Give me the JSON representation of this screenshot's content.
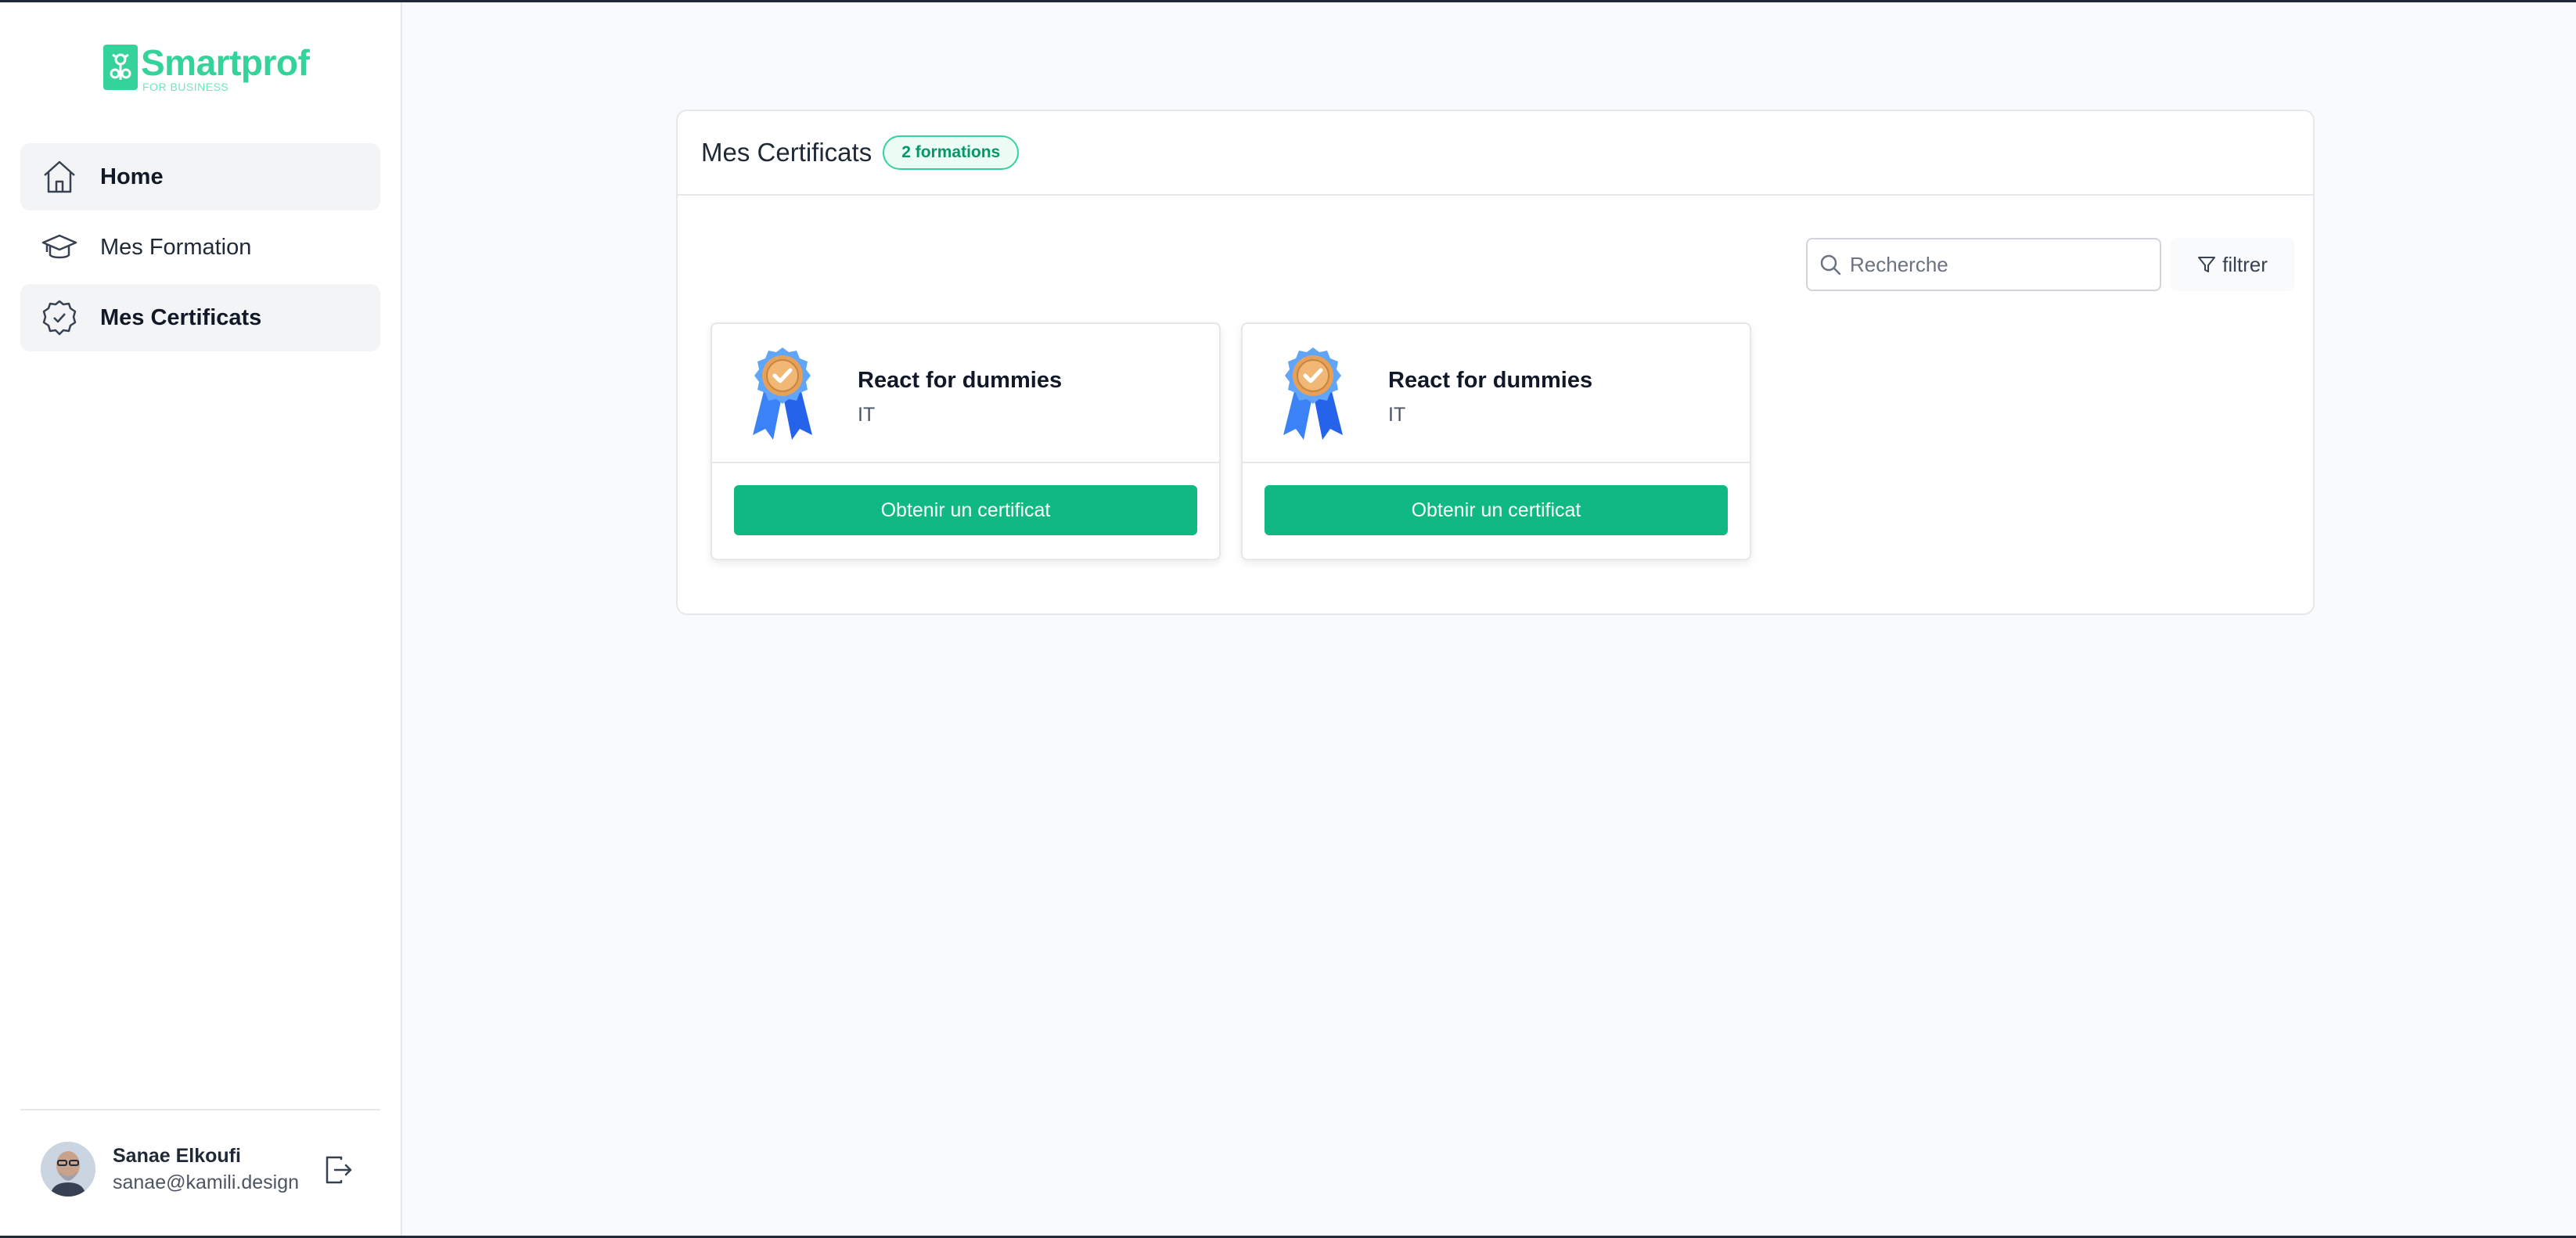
{
  "brand": {
    "name": "Smartprof",
    "tagline": "FOR BUSINESS",
    "color": "#34d399"
  },
  "sidebar": {
    "items": [
      {
        "label": "Home",
        "icon": "home-icon",
        "active": true
      },
      {
        "label": "Mes Formation",
        "icon": "graduation-cap-icon",
        "active": false
      },
      {
        "label": "Mes Certificats",
        "icon": "certificate-check-icon",
        "active": true
      }
    ]
  },
  "user": {
    "name": "Sanae Elkoufi",
    "email": "sanae@kamili.design"
  },
  "main": {
    "title": "Mes Certificats",
    "badge": "2 formations",
    "search": {
      "placeholder": "Recherche",
      "value": ""
    },
    "filter_label": "filtrer",
    "certificates": [
      {
        "title": "React for dummies",
        "category": "IT",
        "button": "Obtenir un certificat"
      },
      {
        "title": "React for dummies",
        "category": "IT",
        "button": "Obtenir un certificat"
      }
    ]
  },
  "colors": {
    "accent": "#10b981",
    "badge_bg": "#ecfdf5",
    "badge_text": "#059669"
  }
}
